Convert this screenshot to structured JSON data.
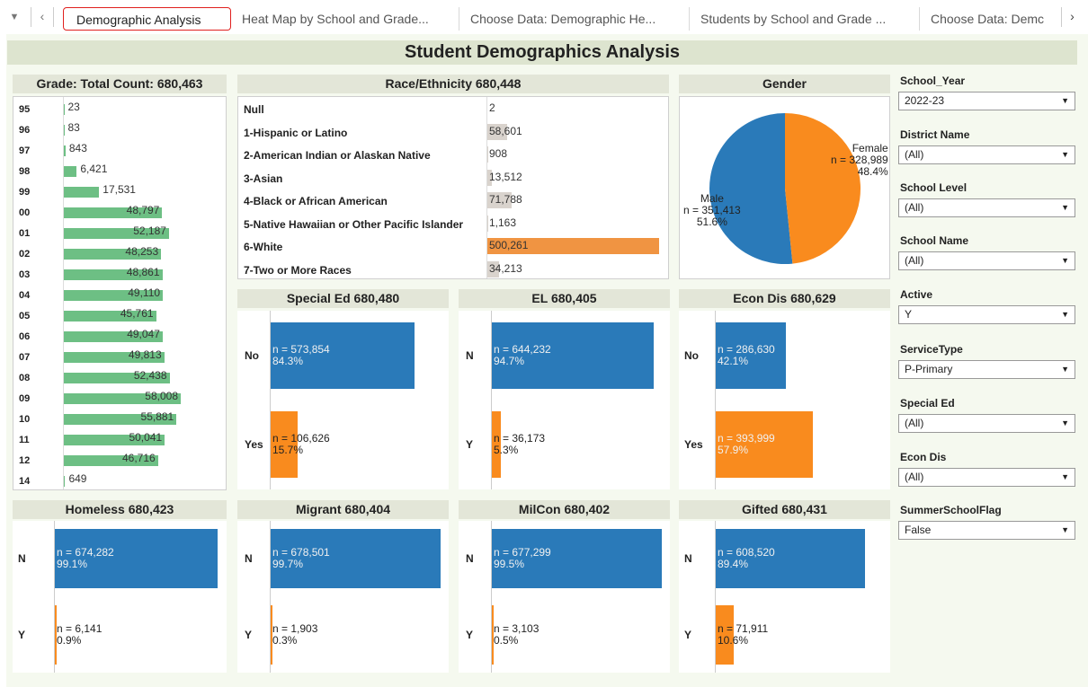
{
  "tabs": [
    {
      "label": "Demographic Analysis",
      "active": true
    },
    {
      "label": "Heat Map by School and Grade..."
    },
    {
      "label": "Choose Data: Demographic He..."
    },
    {
      "label": "Students by School and Grade ..."
    },
    {
      "label": "Choose Data: Demc"
    }
  ],
  "icons": {
    "dropdown": "triangle-down-icon",
    "prev": "chevron-left-icon",
    "next": "chevron-right-icon"
  },
  "title": "Student Demographics Analysis",
  "grade": {
    "title": "Grade: Total Count: 680,463",
    "max": 58008,
    "rows": [
      {
        "label": "95",
        "value": 23,
        "text": "23"
      },
      {
        "label": "96",
        "value": 83,
        "text": "83"
      },
      {
        "label": "97",
        "value": 843,
        "text": "843"
      },
      {
        "label": "98",
        "value": 6421,
        "text": "6,421"
      },
      {
        "label": "99",
        "value": 17531,
        "text": "17,531"
      },
      {
        "label": "00",
        "value": 48797,
        "text": "48,797"
      },
      {
        "label": "01",
        "value": 52187,
        "text": "52,187"
      },
      {
        "label": "02",
        "value": 48253,
        "text": "48,253"
      },
      {
        "label": "03",
        "value": 48861,
        "text": "48,861"
      },
      {
        "label": "04",
        "value": 49110,
        "text": "49,110"
      },
      {
        "label": "05",
        "value": 45761,
        "text": "45,761"
      },
      {
        "label": "06",
        "value": 49047,
        "text": "49,047"
      },
      {
        "label": "07",
        "value": 49813,
        "text": "49,813"
      },
      {
        "label": "08",
        "value": 52438,
        "text": "52,438"
      },
      {
        "label": "09",
        "value": 58008,
        "text": "58,008"
      },
      {
        "label": "10",
        "value": 55881,
        "text": "55,881"
      },
      {
        "label": "11",
        "value": 50041,
        "text": "50,041"
      },
      {
        "label": "12",
        "value": 46716,
        "text": "46,716"
      },
      {
        "label": "14",
        "value": 649,
        "text": "649"
      }
    ]
  },
  "race": {
    "title": "Race/Ethnicity 680,448",
    "max": 500261,
    "rows": [
      {
        "label": "Null",
        "value": 2,
        "text": "2"
      },
      {
        "label": "1-Hispanic or Latino",
        "value": 58601,
        "text": "58,601"
      },
      {
        "label": "2-American Indian or Alaskan Native",
        "value": 908,
        "text": "908"
      },
      {
        "label": "3-Asian",
        "value": 13512,
        "text": "13,512"
      },
      {
        "label": "4-Black or African American",
        "value": 71788,
        "text": "71,788"
      },
      {
        "label": "5-Native Hawaiian or Other Pacific Islander",
        "value": 1163,
        "text": "1,163"
      },
      {
        "label": "6-White",
        "value": 500261,
        "text": "500,261",
        "highlight": true
      },
      {
        "label": "7-Two or More Races",
        "value": 34213,
        "text": "34,213"
      }
    ]
  },
  "gender": {
    "title": "Gender",
    "female": {
      "label": "Female",
      "n": "n = 328,989",
      "pct": "48.4%",
      "fraction": 0.484,
      "color": "#f98b1e"
    },
    "male": {
      "label": "Male",
      "n": "n = 351,413",
      "pct": "51.6%",
      "fraction": 0.516,
      "color": "#2a7ab9"
    }
  },
  "special_ed": {
    "title": "Special Ed 680,480",
    "rows": [
      {
        "label": "No",
        "n": "n = 573,854",
        "pct": "84.3%",
        "fraction": 0.843,
        "color": "#2a7ab9"
      },
      {
        "label": "Yes",
        "n": "n = 106,626",
        "pct": "15.7%",
        "fraction": 0.157,
        "color": "#f98b1e"
      }
    ]
  },
  "el": {
    "title": "EL 680,405",
    "rows": [
      {
        "label": "N",
        "n": "n = 644,232",
        "pct": "94.7%",
        "fraction": 0.947,
        "color": "#2a7ab9"
      },
      {
        "label": "Y",
        "n": "n = 36,173",
        "pct": "5.3%",
        "fraction": 0.053,
        "color": "#f98b1e"
      }
    ]
  },
  "econ_dis": {
    "title": "Econ Dis 680,629",
    "rows": [
      {
        "label": "No",
        "n": "n = 286,630",
        "pct": "42.1%",
        "fraction": 0.421,
        "color": "#2a7ab9"
      },
      {
        "label": "Yes",
        "n": "n = 393,999",
        "pct": "57.9%",
        "fraction": 0.579,
        "color": "#f98b1e"
      }
    ]
  },
  "homeless": {
    "title": "Homeless 680,423",
    "rows": [
      {
        "label": "N",
        "n": "n = 674,282",
        "pct": "99.1%",
        "fraction": 0.991,
        "color": "#2a7ab9"
      },
      {
        "label": "Y",
        "n": "n = 6,141",
        "pct": "0.9%",
        "fraction": 0.009,
        "color": "#f98b1e"
      }
    ]
  },
  "migrant": {
    "title": "Migrant 680,404",
    "rows": [
      {
        "label": "N",
        "n": "n = 678,501",
        "pct": "99.7%",
        "fraction": 0.997,
        "color": "#2a7ab9"
      },
      {
        "label": "Y",
        "n": "n = 1,903",
        "pct": "0.3%",
        "fraction": 0.003,
        "color": "#f98b1e"
      }
    ]
  },
  "milcon": {
    "title": "MilCon 680,402",
    "rows": [
      {
        "label": "N",
        "n": "n = 677,299",
        "pct": "99.5%",
        "fraction": 0.995,
        "color": "#2a7ab9"
      },
      {
        "label": "Y",
        "n": "n = 3,103",
        "pct": "0.5%",
        "fraction": 0.005,
        "color": "#f98b1e"
      }
    ]
  },
  "gifted": {
    "title": "Gifted 680,431",
    "rows": [
      {
        "label": "N",
        "n": "n = 608,520",
        "pct": "89.4%",
        "fraction": 0.894,
        "color": "#2a7ab9"
      },
      {
        "label": "Y",
        "n": "n = 71,911",
        "pct": "10.6%",
        "fraction": 0.106,
        "color": "#f98b1e"
      }
    ]
  },
  "filters": [
    {
      "label": "School_Year",
      "value": "2022-23"
    },
    {
      "label": "District Name",
      "value": "(All)"
    },
    {
      "label": "School Level",
      "value": "(All)"
    },
    {
      "label": "School Name",
      "value": "(All)"
    },
    {
      "label": "Active",
      "value": "Y"
    },
    {
      "label": "ServiceType",
      "value": "P-Primary"
    },
    {
      "label": "Special Ed",
      "value": "(All)"
    },
    {
      "label": "Econ Dis",
      "value": "(All)"
    },
    {
      "label": "SummerSchoolFlag",
      "value": "False"
    }
  ]
}
